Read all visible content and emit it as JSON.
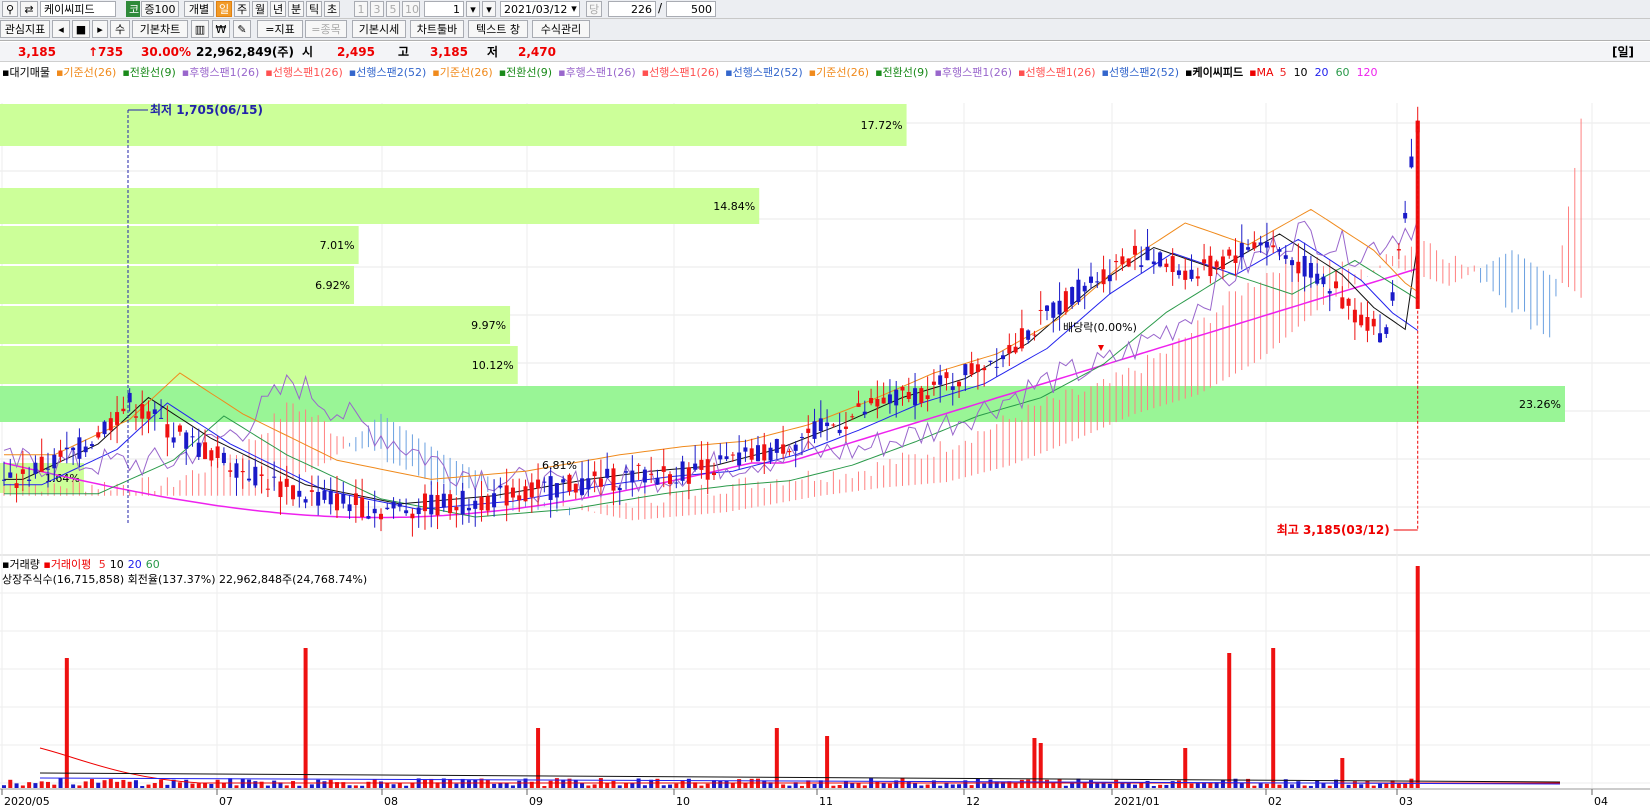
{
  "toolbar": {
    "stock_name": "케이씨피드",
    "market_badge": "코",
    "ratio_badge": "증100",
    "individual": "개별",
    "periods": [
      "일",
      "주",
      "월",
      "년",
      "분",
      "틱",
      "초"
    ],
    "intervals": [
      "1",
      "3",
      "5",
      "10"
    ],
    "interval_value": "1",
    "date": "2021/03/12",
    "date_unit": "당",
    "count_shown": "226",
    "count_total": "500",
    "indicator_btn": "관심지표",
    "plus_btn": "수",
    "basic_chart": "기본차트",
    "indicator": "=지표",
    "stock": "=종목",
    "basic_quote": "기본시세",
    "chart_toolbar": "차트툴바",
    "text_window": "텍스트 창",
    "formula_mgmt": "수식관리"
  },
  "quote": {
    "price": "3,185",
    "change": "↑735",
    "change_pct": "30.00%",
    "volume": "22,962,849(주)",
    "open_label": "시",
    "open": "2,495",
    "high_label": "고",
    "high": "3,185",
    "low_label": "저",
    "low": "2,470",
    "period_tag": "[일]"
  },
  "legend": {
    "items": [
      {
        "text": "대기매물",
        "color": "#000000"
      },
      {
        "text": "기준선(26)",
        "color": "#f08a1c"
      },
      {
        "text": "전환선(9)",
        "color": "#1a8a1a"
      },
      {
        "text": "후행스팬1(26)",
        "color": "#9966cc"
      },
      {
        "text": "선행스팬1(26)",
        "color": "#ff5050"
      },
      {
        "text": "선행스팬2(52)",
        "color": "#3366cc"
      },
      {
        "text": "기준선(26)",
        "color": "#f08a1c"
      },
      {
        "text": "전환선(9)",
        "color": "#1a8a1a"
      },
      {
        "text": "후행스팬1(26)",
        "color": "#9966cc"
      },
      {
        "text": "선행스팬1(26)",
        "color": "#ff5050"
      },
      {
        "text": "선행스팬2(52)",
        "color": "#3366cc"
      },
      {
        "text": "기준선(26)",
        "color": "#f08a1c"
      },
      {
        "text": "전환선(9)",
        "color": "#1a8a1a"
      },
      {
        "text": "후행스팬1(26)",
        "color": "#9966cc"
      },
      {
        "text": "선행스팬1(26)",
        "color": "#ff5050"
      },
      {
        "text": "선행스팬2(52)",
        "color": "#3366cc"
      }
    ],
    "stock": "케이씨피드",
    "ma_label": "MA",
    "ma": [
      {
        "text": "5",
        "color": "#ee2222"
      },
      {
        "text": "10",
        "color": "#000000"
      },
      {
        "text": "20",
        "color": "#2222ee"
      },
      {
        "text": "60",
        "color": "#2a9a4a"
      },
      {
        "text": "120",
        "color": "#ee22ee"
      }
    ]
  },
  "annotations": {
    "low_note": "최저 1,705(06/15)",
    "high_note": "최고 3,185(03/12)",
    "dividend_note": "배당락(0.00%)",
    "small_pct": "6.81%"
  },
  "volume_panel": {
    "legend_title": "거래량",
    "legend_ma_label": "거래이평",
    "ma": [
      {
        "text": "5",
        "color": "#ee2222"
      },
      {
        "text": "10",
        "color": "#000000"
      },
      {
        "text": "20",
        "color": "#2222ee"
      },
      {
        "text": "60",
        "color": "#2a9a4a"
      }
    ],
    "info": "상장주식수(16,715,858) 회전율(137.37%) 22,962,848주(24,768.74%)"
  },
  "x_axis_labels": [
    "2020/05",
    "07",
    "08",
    "09",
    "10",
    "11",
    "12",
    "2021/01",
    "02",
    "03",
    "04"
  ],
  "colors": {
    "up": "#ee1111",
    "down": "#1a1ac8",
    "profile_light": "#ccff99",
    "profile_strong": "#99f596"
  },
  "chart_data": {
    "type": "candlestick",
    "title": "케이씨피드",
    "series_unit": "KRW",
    "ylim": [
      1600,
      3250
    ],
    "categories": [
      "2020/05",
      "07",
      "08",
      "09",
      "10",
      "11",
      "12",
      "2021/01",
      "02",
      "03",
      "04"
    ],
    "volume_profile": [
      {
        "label": "17.72%",
        "value": 17.72
      },
      {
        "label": "14.84%",
        "value": 14.84
      },
      {
        "label": "7.01%",
        "value": 7.01
      },
      {
        "label": "6.92%",
        "value": 6.92
      },
      {
        "label": "9.97%",
        "value": 9.97
      },
      {
        "label": "10.12%",
        "value": 10.12
      },
      {
        "label": "23.26%",
        "value": 23.26
      },
      {
        "label": "1.64%",
        "value": 1.64
      }
    ],
    "highlights": {
      "low": 1705,
      "low_date": "06/15",
      "high": 3185,
      "high_date": "03/12"
    },
    "last": {
      "open": 2495,
      "high": 3185,
      "low": 2470,
      "close": 3185,
      "change_pct": 30.0
    }
  }
}
